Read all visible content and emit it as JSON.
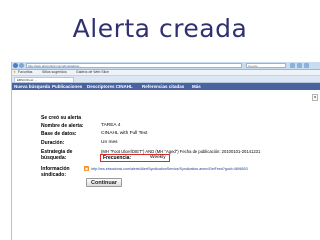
{
  "slide": {
    "title": "Alerta creada"
  },
  "browser": {
    "url": "http://web.ebscohost.com/ehost/alerts/...",
    "search_placeholder": "Google",
    "favorites_label": "Favoritos",
    "favorites_items": [
      "Sitios sugeridos",
      "Galería de Web Slice"
    ],
    "tab_title": "EBSCOhost: ..."
  },
  "menu": {
    "items": [
      "Nueva búsqueda",
      "Publicaciones",
      "Descriptores CINAHL",
      "Referencias citadas",
      "Más"
    ]
  },
  "alert_form": {
    "fields": [
      {
        "label": "Se creó su alerta",
        "value": ""
      },
      {
        "label": "Nombre de alerta:",
        "value": "TAREA 4"
      },
      {
        "label": "Base de datos:",
        "value": "CINAHL with Full Text"
      },
      {
        "label": "Duración:",
        "value": "Un mes"
      },
      {
        "label": "Estrategia de búsqueda:",
        "value": "(MH \"Foot Ulcer/DIET\") AND (MH \"Aged\") Fecha de publicación: 20100101-20141231"
      },
      {
        "label": "Frecuencia:",
        "value": "Weekly"
      },
      {
        "label": "Información sindicado:",
        "value": "http://rss.ebscohost.com/alerts/AlertSyndicationService/Syndication.asmx/GetFeed?guid=4896503"
      }
    ],
    "continue_label": "Continuar"
  },
  "colors": {
    "menu_bg": "#4a62a0",
    "title": "#303070",
    "highlight": "#d52b2b"
  }
}
